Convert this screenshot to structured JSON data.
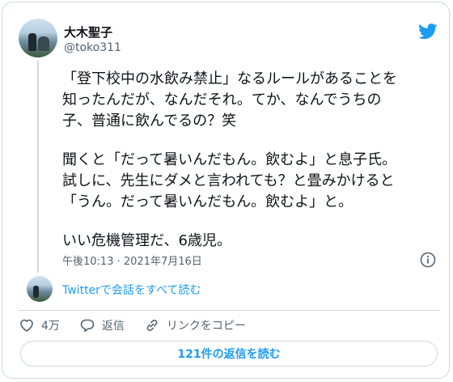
{
  "user": {
    "display_name": "大木聖子",
    "handle": "@toko311"
  },
  "tweet": {
    "paragraphs": [
      "「登下校中の水飲み禁止」なるルールがあることを\n知ったんだが、なんだそれ。てか、なんでうちの\n子、普通に飲んでるの？笑",
      "聞くと「だって暑いんだもん。飲むよ」と息子氏。\n試しに、先生にダメと言われても？と畳みかけると\n「うん。だって暑いんだもん。飲むよ」と。",
      "いい危機管理だ、6歳児。"
    ],
    "timestamp": "午後10:13 · 2021年7月16日"
  },
  "thread": {
    "read_all_label": "Twitterで会話をすべて読む"
  },
  "actions": {
    "likes_count": "4万",
    "reply_label": "返信",
    "copy_link_label": "リンクをコピー"
  },
  "replies_button": {
    "label": "121件の返信を読む"
  },
  "colors": {
    "accent": "#1d9bf0",
    "text": "#0f1419",
    "muted": "#536471",
    "border": "#cfd9de"
  },
  "icons": [
    "twitter-bird-icon",
    "info-icon",
    "heart-icon",
    "reply-icon",
    "link-icon"
  ]
}
